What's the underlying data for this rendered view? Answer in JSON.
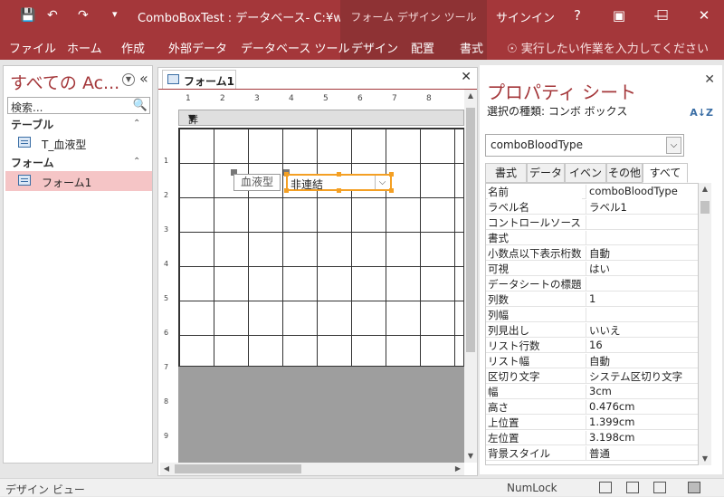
{
  "titlebar": {
    "title": "ComboBoxTest : データベース- C:¥w...",
    "context_tool_title": "フォーム デザイン ツール",
    "signin": "サインイン",
    "help": "?",
    "save_icon": "save-icon",
    "undo_icon": "undo-icon",
    "redo_icon": "redo-icon",
    "customize_icon": "customize-qat-icon"
  },
  "ribbon": {
    "tabs": [
      "ファイル",
      "ホーム",
      "作成",
      "外部データ",
      "データベース ツール"
    ],
    "context_tabs": [
      "デザイン",
      "配置",
      "書式"
    ],
    "tell_me": "実行したい作業を入力してください"
  },
  "nav": {
    "title": "すべての Ac...",
    "search_placeholder": "検索...",
    "groups": [
      {
        "label": "テーブル",
        "items": [
          "T_血液型"
        ]
      },
      {
        "label": "フォーム",
        "items": [
          "フォーム1"
        ]
      }
    ]
  },
  "document": {
    "tab_label": "フォーム1",
    "section_label": "詳細",
    "label_control": "血液型",
    "combo_control": "非連結",
    "hruler_ticks": [
      "1",
      "2",
      "3",
      "4",
      "5",
      "6",
      "7",
      "8"
    ],
    "vruler_ticks": [
      "1",
      "2",
      "3",
      "4",
      "5",
      "6",
      "7",
      "8",
      "9"
    ]
  },
  "property_sheet": {
    "title": "プロパティ シート",
    "selection_type": "選択の種類: コンボ ボックス",
    "selected_object": "comboBloodType",
    "tabs": [
      "書式",
      "データ",
      "イベント",
      "その他",
      "すべて"
    ],
    "active_tab": "すべて",
    "rows": [
      {
        "name": "名前",
        "value": "comboBloodType"
      },
      {
        "name": "ラベル名",
        "value": "ラベル1"
      },
      {
        "name": "コントロールソース",
        "value": ""
      },
      {
        "name": "書式",
        "value": ""
      },
      {
        "name": "小数点以下表示桁数",
        "value": "自動"
      },
      {
        "name": "可視",
        "value": "はい"
      },
      {
        "name": "データシートの標題",
        "value": ""
      },
      {
        "name": "列数",
        "value": "1"
      },
      {
        "name": "列幅",
        "value": ""
      },
      {
        "name": "列見出し",
        "value": "いいえ"
      },
      {
        "name": "リスト行数",
        "value": "16"
      },
      {
        "name": "リスト幅",
        "value": "自動"
      },
      {
        "name": "区切り文字",
        "value": "システム区切り文字"
      },
      {
        "name": "幅",
        "value": "3cm"
      },
      {
        "name": "高さ",
        "value": "0.476cm"
      },
      {
        "name": "上位置",
        "value": "1.399cm"
      },
      {
        "name": "左位置",
        "value": "3.198cm"
      },
      {
        "name": "背景スタイル",
        "value": "普通"
      }
    ]
  },
  "statusbar": {
    "text": "デザイン ビュー",
    "numlock": "NumLock"
  },
  "colors": {
    "accent": "#a4373a",
    "context_tab_bg": "#8e3234",
    "selection_orange": "#f4a024",
    "nav_selected": "#f5c5c6"
  }
}
